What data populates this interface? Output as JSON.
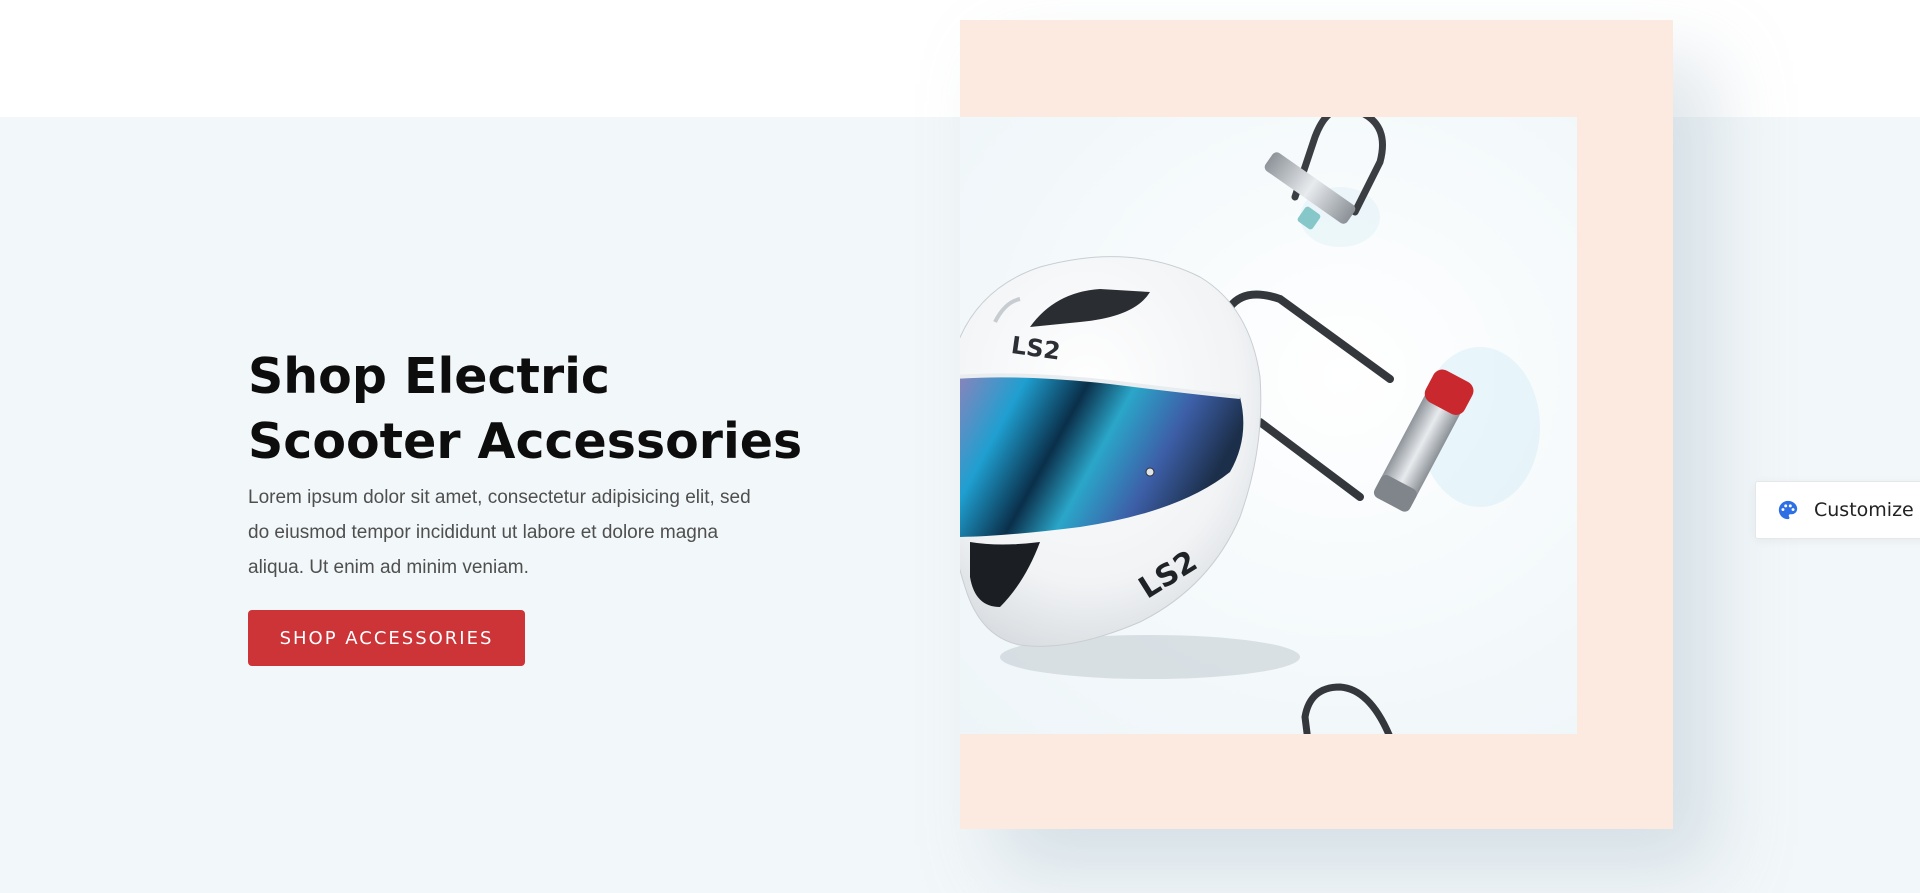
{
  "hero": {
    "heading_line1": "Shop Electric",
    "heading_line2": "Scooter Accessories",
    "description": "Lorem ipsum dolor sit amet, consectetur adipisicing elit, sed do eiusmod tempor incididunt ut labore et dolore magna aliqua. Ut enim ad minim veniam.",
    "cta_label": "SHOP ACCESSORIES",
    "product_image": {
      "items": [
        "helmet",
        "u-lock"
      ],
      "helmet_brand_text": "LS2"
    }
  },
  "customize": {
    "label": "Customize",
    "icon": "palette-icon"
  },
  "colors": {
    "band_background": "#f2f7f9",
    "frame_peach": "#fce9df",
    "cta_red": "#cc3438",
    "heading": "#0d0d0d",
    "palette_icon_blue": "#2f6fe4"
  }
}
